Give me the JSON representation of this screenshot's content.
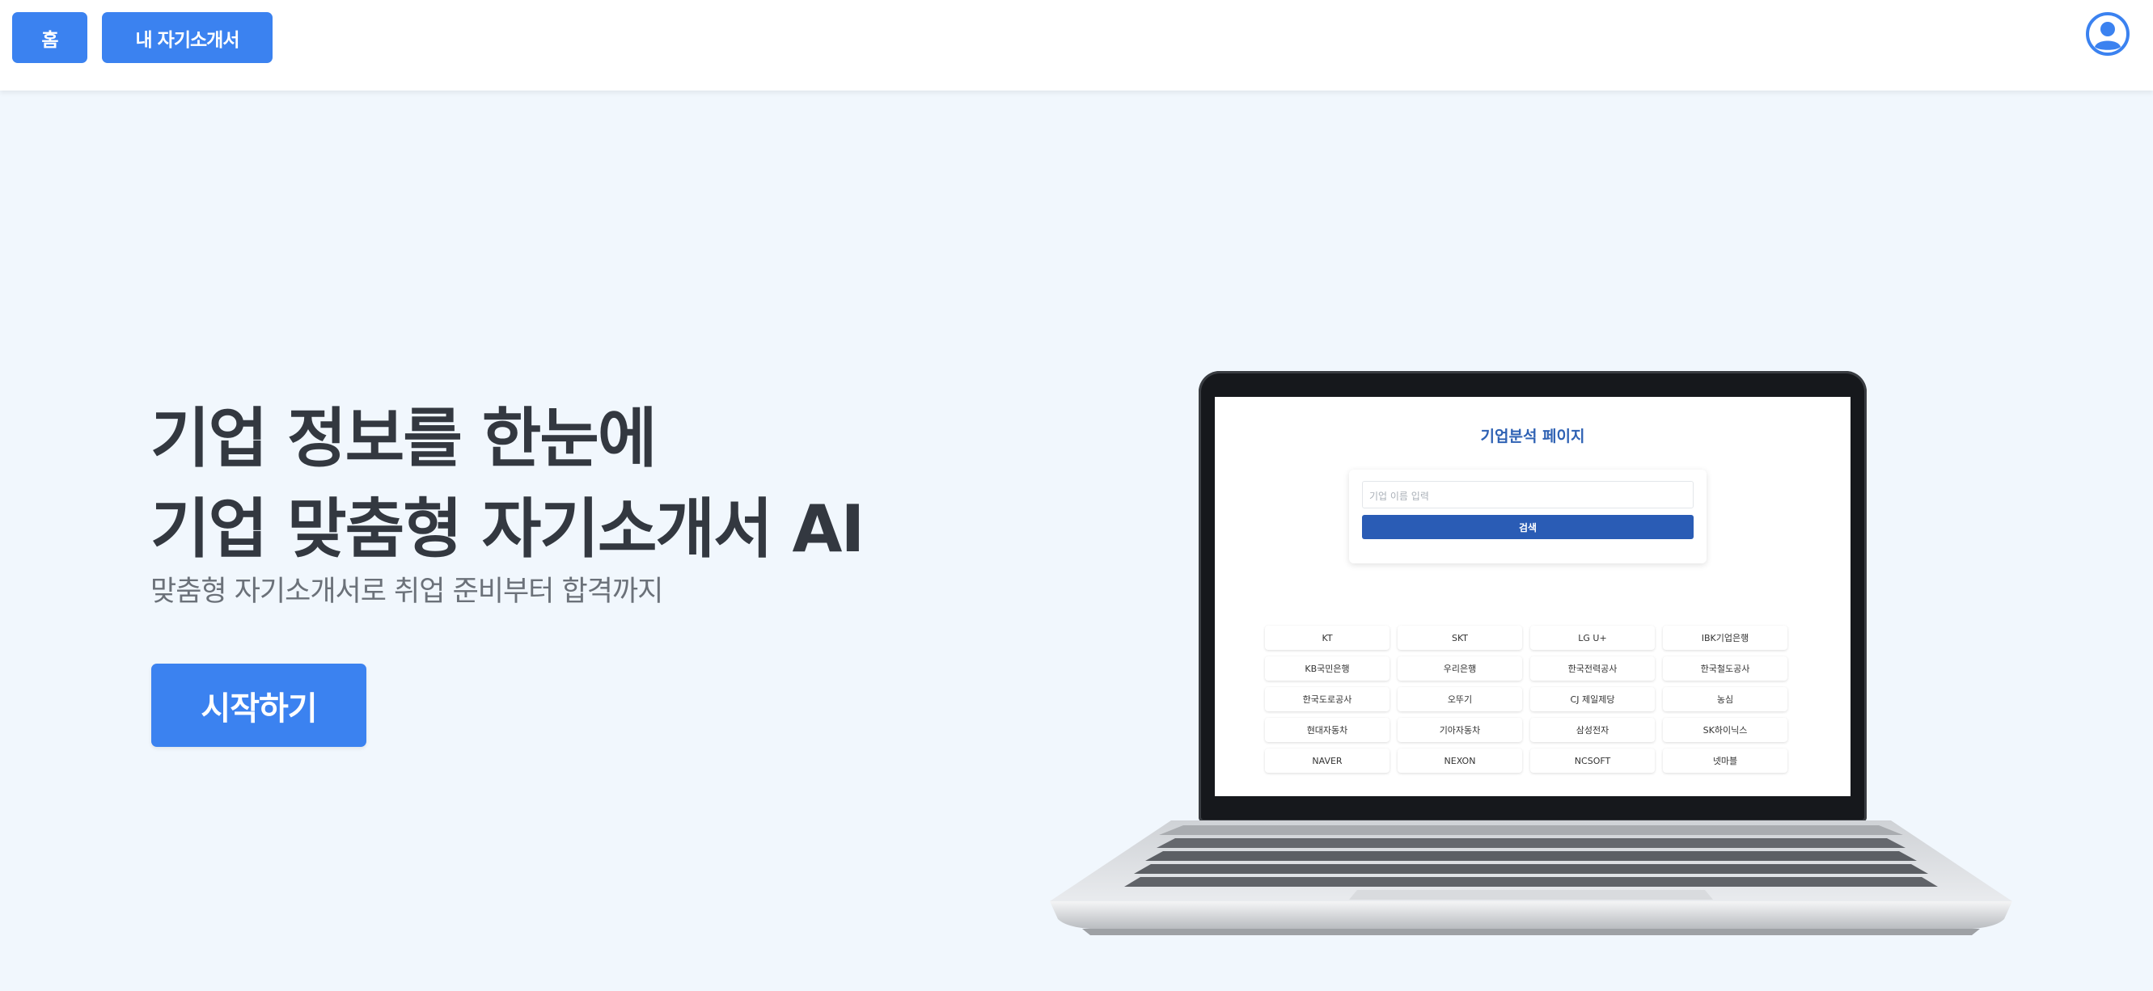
{
  "nav": {
    "home_label": "홈",
    "my_resume_label": "내 자기소개서"
  },
  "hero": {
    "title_line1": "기업 정보를 한눈에",
    "title_line2": "기업 맞춤형 자기소개서 AI",
    "subtitle": "맞춤형 자기소개서로 취업 준비부터 합격까지",
    "start_button": "시작하기"
  },
  "preview": {
    "page_title": "기업분석 페이지",
    "search_placeholder": "기업 이름 입력",
    "search_button": "검색",
    "companies": [
      "KT",
      "SKT",
      "LG U+",
      "IBK기업은행",
      "KB국민은행",
      "우리은행",
      "한국전력공사",
      "한국철도공사",
      "한국도로공사",
      "오뚜기",
      "CJ 제일제당",
      "농심",
      "현대자동차",
      "기아자동차",
      "삼성전자",
      "SK하이닉스",
      "NAVER",
      "NEXON",
      "NCSOFT",
      "넷마블"
    ]
  },
  "colors": {
    "accent": "#3b82f0",
    "page_background": "#f1f7fd",
    "heading_text": "#333840",
    "preview_title": "#2f62b4",
    "preview_button": "#2a5cb5"
  },
  "icons": {
    "profile": "user-circle-icon"
  }
}
